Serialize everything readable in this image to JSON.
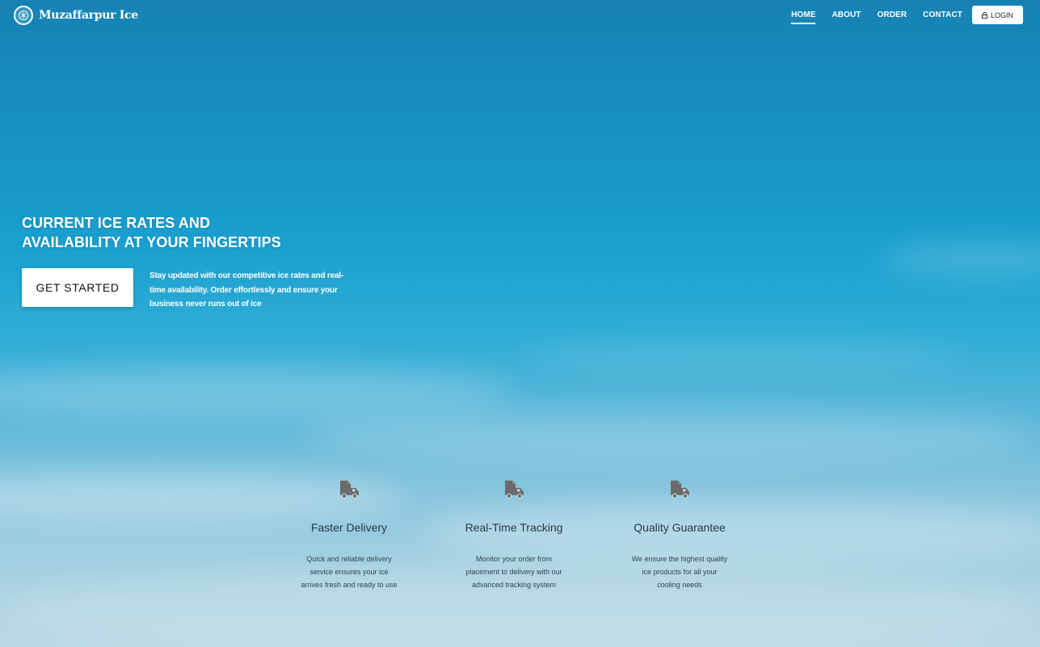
{
  "brand": {
    "name": "Muzaffarpur Ice",
    "logo_icon": "ice-emblem-icon"
  },
  "nav": {
    "items": [
      {
        "label": "HOME",
        "active": true
      },
      {
        "label": "ABOUT",
        "active": false
      },
      {
        "label": "ORDER",
        "active": false
      },
      {
        "label": "CONTACT",
        "active": false
      }
    ],
    "login_label": "LOGIN",
    "login_icon": "lock-icon"
  },
  "hero": {
    "title_line1": "CURRENT ICE RATES AND",
    "title_line2": "AVAILABILITY AT YOUR FINGERTIPS",
    "cta_label": "GET STARTED",
    "description": "Stay updated with our competitive ice rates and real-time availability. Order effortlessly and ensure your business never runs out of ice"
  },
  "features": [
    {
      "icon": "delivery-truck-icon",
      "title": "Faster Delivery",
      "text": "Quick and reliable delivery service ensures your ice arrives fresh and ready to use"
    },
    {
      "icon": "delivery-truck-icon",
      "title": "Real-Time Tracking",
      "text": "Monitor your order from placement to delivery with our advanced tracking system"
    },
    {
      "icon": "delivery-truck-icon",
      "title": "Quality Guarantee",
      "text": "We ensure the highest quality ice products for all your cooling needs"
    }
  ],
  "colors": {
    "sky_top": "#1682b3",
    "sky_bottom": "#bad9e6",
    "icon_gray": "#6b6b6b",
    "text_white": "#ffffff"
  }
}
